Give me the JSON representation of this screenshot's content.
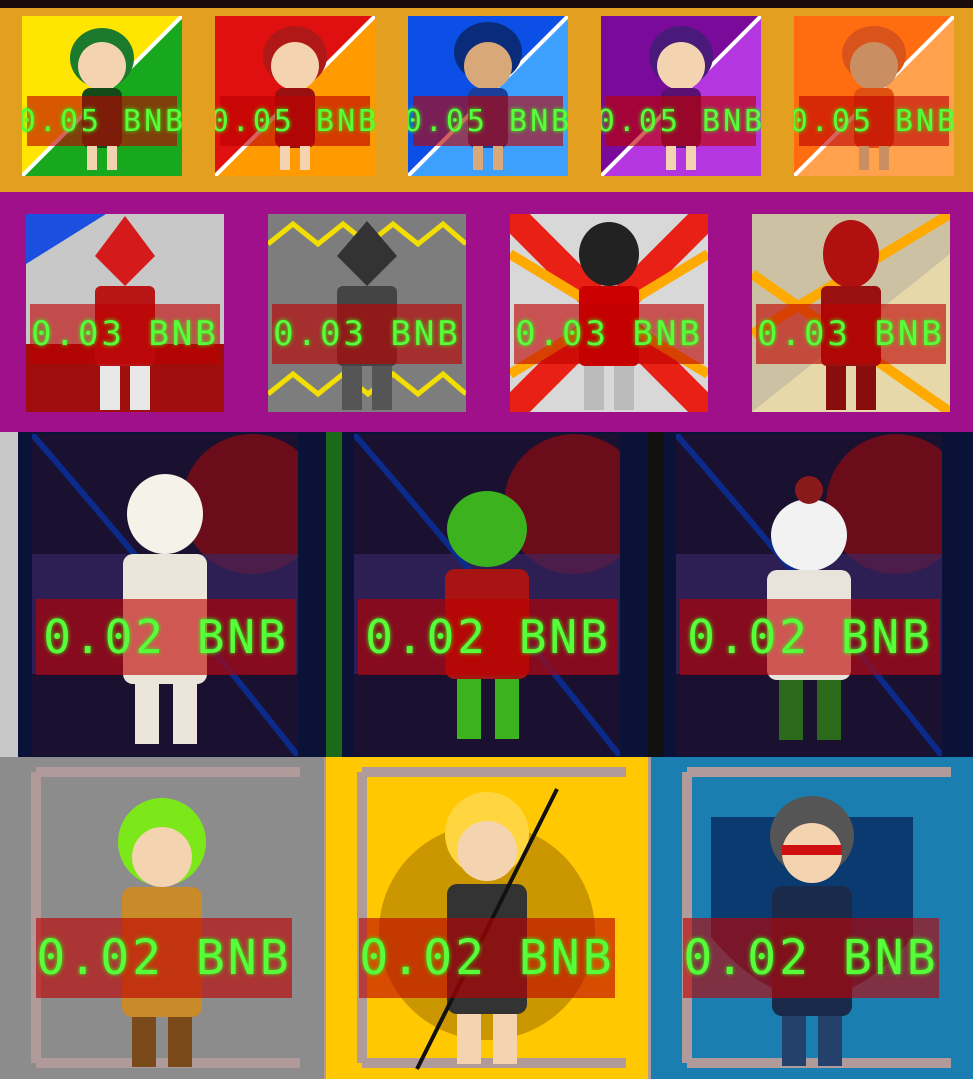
{
  "rows": [
    {
      "tier": "tier-1",
      "items": [
        {
          "price": "0.05 BNB",
          "colors": [
            "#ffe600",
            "#18a81e"
          ]
        },
        {
          "price": "0.05 BNB",
          "colors": [
            "#e01010",
            "#ff9a00"
          ]
        },
        {
          "price": "0.05 BNB",
          "colors": [
            "#0c4fe6",
            "#3da0ff"
          ]
        },
        {
          "price": "0.05 BNB",
          "colors": [
            "#7a0a9a",
            "#b436e0"
          ]
        },
        {
          "price": "0.05 BNB",
          "colors": [
            "#ff6d10",
            "#ffa14d"
          ]
        }
      ]
    },
    {
      "tier": "tier-2",
      "items": [
        {
          "price": "0.03 BNB",
          "colors": [
            "#c8c8c8",
            "#1b4fe0"
          ]
        },
        {
          "price": "0.03 BNB",
          "colors": [
            "#7d7d7d",
            "#f2de00"
          ]
        },
        {
          "price": "0.03 BNB",
          "colors": [
            "#d8d8d8",
            "#e82015"
          ]
        },
        {
          "price": "0.03 BNB",
          "colors": [
            "#e6d8a8",
            "#ffaa00"
          ]
        }
      ]
    },
    {
      "tier": "tier-3",
      "items": [
        {
          "price": "0.02 BNB"
        },
        {
          "price": "0.02 BNB"
        },
        {
          "price": "0.02 BNB"
        }
      ]
    },
    {
      "tier": "tier-4",
      "items": [
        {
          "price": "0.02 BNB",
          "colors": [
            "#8c8c8c",
            "#b09a9a"
          ]
        },
        {
          "price": "0.02 BNB",
          "colors": [
            "#ffc800",
            "#b09a9a"
          ]
        },
        {
          "price": "0.02 BNB",
          "colors": [
            "#1a7fb0",
            "#b09a9a"
          ]
        }
      ]
    }
  ]
}
